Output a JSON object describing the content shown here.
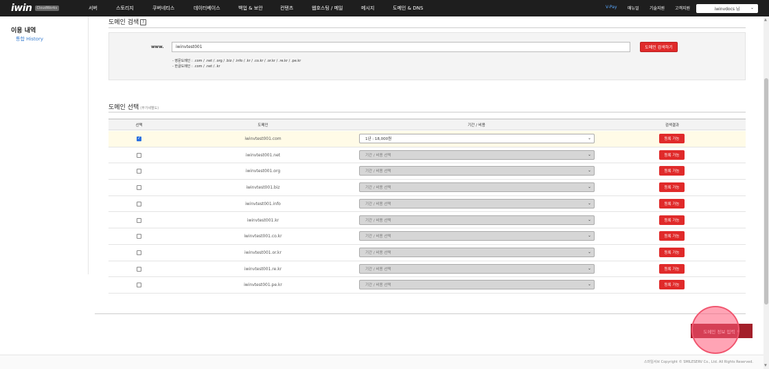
{
  "header": {
    "logo": "iwin",
    "logo_badge": "CloudWorks",
    "nav": [
      "서버",
      "스토리지",
      "쿠버네티스",
      "데이터베이스",
      "백업 & 보안",
      "컨텐츠",
      "웹호스팅 / 메일",
      "메시지",
      "도메인 & DNS"
    ],
    "util": [
      "V-Pay",
      "매뉴얼",
      "기술지원",
      "고객지원"
    ],
    "user": "iwinvdocs 님"
  },
  "sidebar": {
    "title": "이용 내역",
    "link": "통합 History"
  },
  "search_section": {
    "title": "도메인 검색",
    "help": "?",
    "www_label": "www.",
    "input_value": "iwinvtest001",
    "button": "도메인 검색하기",
    "notes": [
      "- 영문도메인 : .com / .net / .org / .biz / .info / .kr / .co.kr / .or.kr / .re.kr / .pe.kr",
      "- 한글도메인 : .com / .net / .kr"
    ]
  },
  "select_section": {
    "title": "도메인 선택",
    "subtitle": "(부가세별도)",
    "columns": [
      "선택",
      "도메인",
      "기간 / 비용",
      "검색결과"
    ],
    "rows": [
      {
        "domain": "iwinvtest001.com",
        "checked": true,
        "period": "1년 : 18,000원",
        "status": "등록 가능"
      },
      {
        "domain": "iwinvtest001.net",
        "checked": false,
        "period": "기간 / 비용 선택",
        "status": "등록 가능"
      },
      {
        "domain": "iwinvtest001.org",
        "checked": false,
        "period": "기간 / 비용 선택",
        "status": "등록 가능"
      },
      {
        "domain": "iwinvtest001.biz",
        "checked": false,
        "period": "기간 / 비용 선택",
        "status": "등록 가능"
      },
      {
        "domain": "iwinvtest001.info",
        "checked": false,
        "period": "기간 / 비용 선택",
        "status": "등록 가능"
      },
      {
        "domain": "iwinvtest001.kr",
        "checked": false,
        "period": "기간 / 비용 선택",
        "status": "등록 가능"
      },
      {
        "domain": "iwinvtest001.co.kr",
        "checked": false,
        "period": "기간 / 비용 선택",
        "status": "등록 가능"
      },
      {
        "domain": "iwinvtest001.or.kr",
        "checked": false,
        "period": "기간 / 비용 선택",
        "status": "등록 가능"
      },
      {
        "domain": "iwinvtest001.re.kr",
        "checked": false,
        "period": "기간 / 비용 선택",
        "status": "등록 가능"
      },
      {
        "domain": "iwinvtest001.pe.kr",
        "checked": false,
        "period": "기간 / 비용 선택",
        "status": "등록 가능"
      }
    ]
  },
  "next_button": "도메인 정보 입력",
  "footer": {
    "copyright": "스마일서브 Copyright © SMILESERV Co., Ltd. All Rights Reserved."
  },
  "colors": {
    "accent_red": "#e02a2a",
    "next_red": "#a31f2a",
    "nav_bg": "#1e1e1e",
    "link_blue": "#3b7fd1"
  }
}
